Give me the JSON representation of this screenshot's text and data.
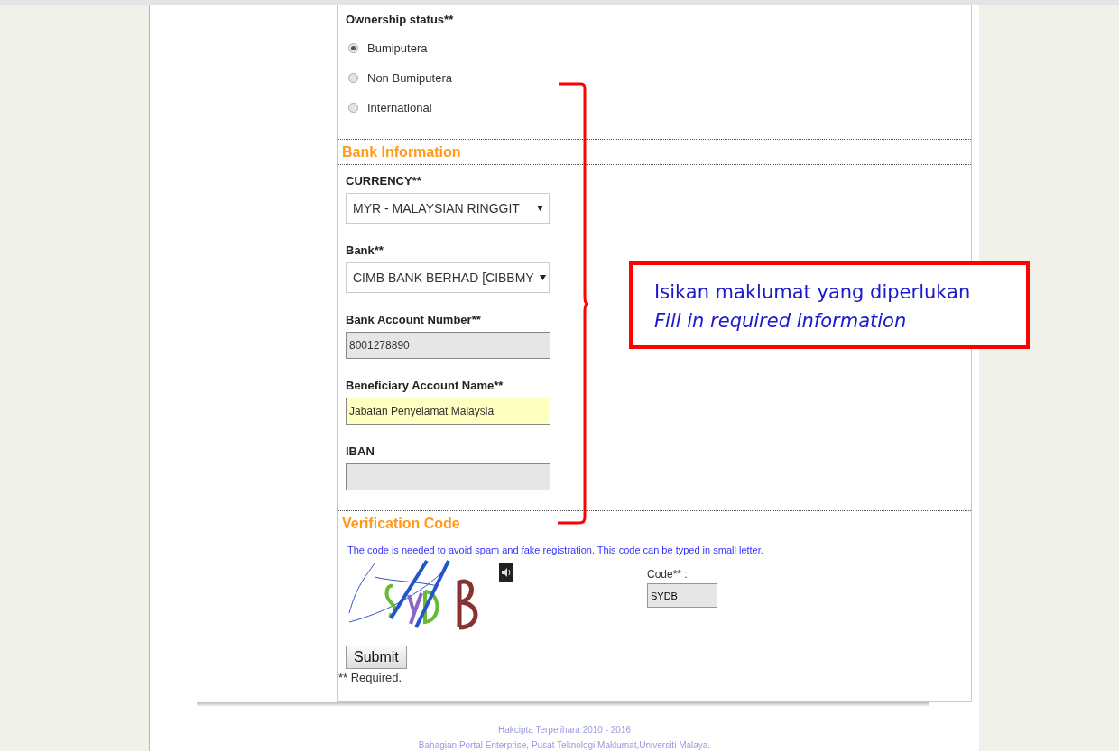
{
  "ownership": {
    "label": "Ownership status**",
    "options": [
      {
        "label": "Bumiputera",
        "selected": true
      },
      {
        "label": "Non Bumiputera",
        "selected": false
      },
      {
        "label": "International",
        "selected": false
      }
    ]
  },
  "bank_section": {
    "title": "Bank Information",
    "fields": [
      {
        "kind": "select",
        "label": "CURRENCY**",
        "value": "MYR - MALAYSIAN RINGGIT"
      },
      {
        "kind": "select",
        "label": "Bank**",
        "value": "CIMB BANK BERHAD [CIBBMY"
      },
      {
        "kind": "text",
        "label": "Bank Account Number**",
        "value": "8001278890",
        "highlighted": false
      },
      {
        "kind": "text",
        "label": "Beneficiary Account Name**",
        "value": "Jabatan Penyelamat Malaysia",
        "highlighted": true
      },
      {
        "kind": "text",
        "label": "IBAN",
        "highlighted": false
      }
    ]
  },
  "verification": {
    "title": "Verification Code",
    "note": "The code is needed to avoid spam and fake registration. This code can be typed in small letter.",
    "code_label": "Code** :",
    "code_value": "SYDB"
  },
  "submit": "Submit",
  "required_note": "** Required.",
  "footer": [
    "Hakcipta Terpelihara 2010 - 2016",
    "Bahagian Portal Enterprise, Pusat Teknologi Maklumat,Universiti Malaya."
  ],
  "annotation": {
    "lines": [
      {
        "text": "Isikan maklumat yang diperlukan",
        "italic": false
      },
      {
        "text": "Fill in required information",
        "italic": true
      }
    ]
  }
}
